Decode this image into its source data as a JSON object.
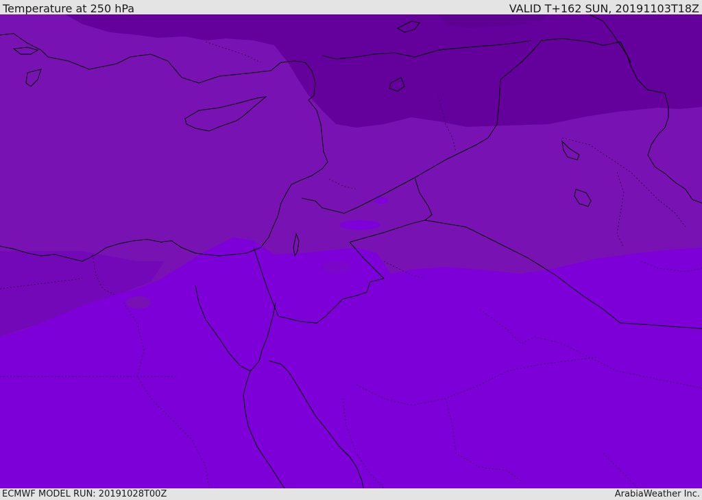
{
  "header": {
    "title": "Temperature at 250 hPa",
    "valid_time": "VALID T+162 SUN, 20191103T18Z"
  },
  "footer": {
    "model_run": "ECMWF MODEL RUN: 20191028T00Z",
    "provider": "ArabiaWeather Inc."
  },
  "map": {
    "field": "temperature-250hPa",
    "colors": {
      "band_coldest": "#64009b",
      "band_cold": "#7812b2",
      "band_warmish": "#7a0ad0",
      "band_warm": "#7d00d9",
      "coastline": "#000000",
      "border_dotted": "#2a0040"
    }
  }
}
